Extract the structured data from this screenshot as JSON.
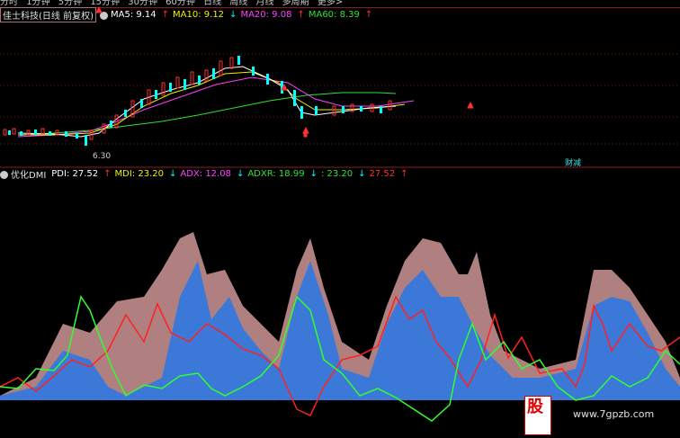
{
  "period_tabs": [
    "分时",
    "1分钟",
    "5分钟",
    "15分钟",
    "30分钟",
    "60分钟",
    "日线",
    "周线",
    "月线",
    "多周期",
    "更多>"
  ],
  "price_panel": {
    "stock_label": "佳士科技(日线 前复权)",
    "ma5_label": "MA5: 9.14",
    "ma10_label": "MA10: 9.12",
    "ma20_label": "MA20: 9.08",
    "ma60_label": "MA60: 8.39",
    "low_label": "6.30",
    "event_label": "财减"
  },
  "dmi_panel": {
    "indicator_label": "优化DMI",
    "pdi_label": "PDI: 27.52",
    "mdi_label": "MDI: 23.20",
    "adx_label": "ADX: 12.08",
    "adxr_label": "ADXR: 18.99",
    "extra1_label": ": 23.20",
    "extra2_label": "27.52"
  },
  "watermark": {
    "char": "股",
    "url": "www.7gpzb.com"
  },
  "colors": {
    "up": "#ff3030",
    "down": "#00ffff",
    "ma5": "#ffffff",
    "ma10": "#f0f000",
    "ma20": "#ff40ff",
    "ma60": "#30e030",
    "pdi": "#ff2020",
    "mdi": "#30ff30",
    "adx_fill": "#3c78d8",
    "adxr_fill": "#b08080"
  }
}
